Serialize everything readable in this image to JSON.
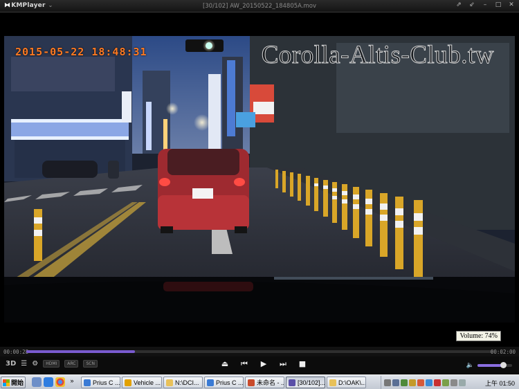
{
  "titlebar": {
    "app_name": "KMPlayer",
    "window_title": "[30/102] AW_20150522_184805A.mov",
    "buttons": [
      "pin-icon",
      "shrink-icon",
      "minimize-icon",
      "maximize-icon",
      "close-icon"
    ]
  },
  "osd": {
    "watermark": "Corolla-Altis-Club.tw",
    "timestamp": "2015-05-22 18:48:31",
    "volume_label": "Volume: 74%"
  },
  "seek": {
    "current": "00:00:28",
    "duration": "00:02:00",
    "progress": 0.233
  },
  "controls": {
    "mode_3d": "3D",
    "pills": [
      "HDMI",
      "ARC",
      "SCN"
    ],
    "buttons": [
      "eject-icon",
      "previous-icon",
      "play-icon",
      "next-icon",
      "stop-icon"
    ],
    "volume": 0.74
  },
  "taskbar": {
    "start_label": "開始",
    "tasks": [
      {
        "label": "Prius C ...",
        "icon_color": "#3a7bd5",
        "width": 57,
        "active": false
      },
      {
        "label": "Vehicle ...",
        "icon_color": "#e2a100",
        "width": 58,
        "active": false
      },
      {
        "label": "N:\\DCI...",
        "icon_color": "#e8c15a",
        "width": 57,
        "active": false
      },
      {
        "label": "Prius C ...",
        "icon_color": "#3a7bd5",
        "width": 57,
        "active": false
      },
      {
        "label": "未命名 - ...",
        "icon_color": "#c94b2c",
        "width": 57,
        "active": false
      },
      {
        "label": "[30/102]...",
        "icon_color": "#5a4fa8",
        "width": 57,
        "active": true
      },
      {
        "label": "D:\\OAK\\...",
        "icon_color": "#e8c15a",
        "width": 57,
        "active": false
      }
    ],
    "clock": "上午 01:50",
    "colors": {
      "accent": "#7a5bd0",
      "timestamp": "#ff7a22"
    }
  }
}
